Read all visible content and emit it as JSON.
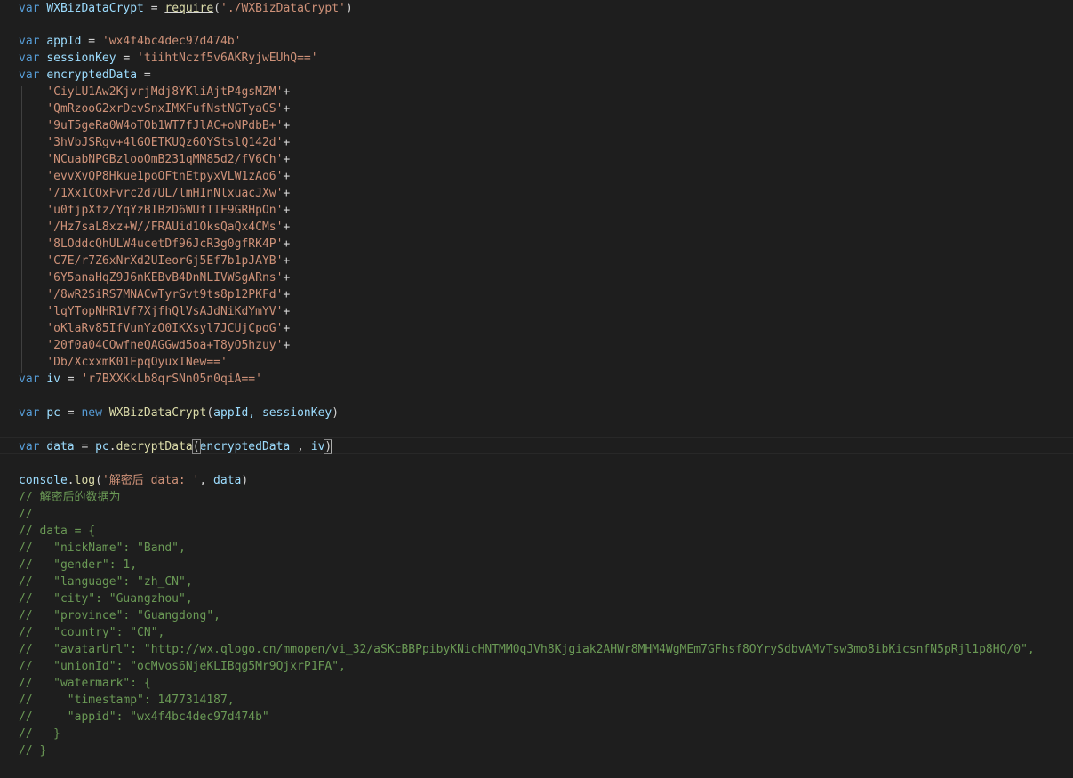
{
  "editor": {
    "keywords": {
      "var": "var",
      "new": "new"
    },
    "line1": {
      "ident": "WXBizDataCrypt",
      "op": " = ",
      "fn": "require",
      "str": "'./WXBizDataCrypt'"
    },
    "appId": {
      "name": "appId",
      "value": "'wx4f4bc4dec97d474b'"
    },
    "sessionKey": {
      "name": "sessionKey",
      "value": "'tiihtNczf5v6AKRyjwEUhQ=='"
    },
    "encrypted": {
      "name": "encryptedData",
      "parts": [
        "'CiyLU1Aw2KjvrjMdj8YKliAjtP4gsMZM'",
        "'QmRzooG2xrDcvSnxIMXFufNstNGTyaGS'",
        "'9uT5geRa0W4oTOb1WT7fJlAC+oNPdbB+'",
        "'3hVbJSRgv+4lGOETKUQz6OYStslQ142d'",
        "'NCuabNPGBzlooOmB231qMM85d2/fV6Ch'",
        "'evvXvQP8Hkue1poOFtnEtpyxVLW1zAo6'",
        "'/1Xx1COxFvrc2d7UL/lmHInNlxuacJXw'",
        "'u0fjpXfz/YqYzBIBzD6WUfTIF9GRHpOn'",
        "'/Hz7saL8xz+W//FRAUid1OksQaQx4CMs'",
        "'8LOddcQhULW4ucetDf96JcR3g0gfRK4P'",
        "'C7E/r7Z6xNrXd2UIeorGj5Ef7b1pJAYB'",
        "'6Y5anaHqZ9J6nKEBvB4DnNLIVWSgARns'",
        "'/8wR2SiRS7MNACwTyrGvt9ts8p12PKFd'",
        "'lqYTopNHR1Vf7XjfhQlVsAJdNiKdYmYV'",
        "'oKlaRv85IfVunYzO0IKXsyl7JCUjCpoG'",
        "'20f0a04COwfneQAGGwd5oa+T8yO5hzuy'",
        "'Db/XcxxmK01EpqOyuxINew=='"
      ]
    },
    "iv": {
      "name": "iv",
      "value": "'r7BXXKkLb8qrSNn05n0qiA=='"
    },
    "pcLine": {
      "name": "pc",
      "cls": "WXBizDataCrypt",
      "args": "appId, sessionKey"
    },
    "dataLine": {
      "name": "data",
      "obj": "pc",
      "method": "decryptData",
      "arg1": "encryptedData",
      "arg2": "iv"
    },
    "logLine": {
      "obj": "console",
      "method": "log",
      "str": "'解密后 data: '",
      "arg": "data"
    },
    "comments": {
      "c1": "// 解密后的数据为",
      "c2": "//",
      "c3": "// data = {",
      "c4": "//   \"nickName\": \"Band\",",
      "c5a": "//   \"gender\": ",
      "c5b": "1",
      "c5c": ",",
      "c6": "//   \"language\": \"zh_CN\",",
      "c7": "//   \"city\": \"Guangzhou\",",
      "c8": "//   \"province\": \"Guangdong\",",
      "c9": "//   \"country\": \"CN\",",
      "c10a": "//   \"avatarUrl\": \"",
      "c10url": "http://wx.qlogo.cn/mmopen/vi_32/aSKcBBPpibyKNicHNTMM0qJVh8Kjgiak2AHWr8MHM4WgMEm7GFhsf8OYrySdbvAMvTsw3mo8ibKicsnfN5pRjl1p8HQ/0",
      "c10b": "\",",
      "c11": "//   \"unionId\": \"ocMvos6NjeKLIBqg5Mr9QjxrP1FA\",",
      "c12": "//   \"watermark\": {",
      "c13a": "//     \"timestamp\": ",
      "c13b": "1477314187",
      "c13c": ",",
      "c14": "//     \"appid\": \"wx4f4bc4dec97d474b\"",
      "c15": "//   }",
      "c16": "// }"
    },
    "colors": {
      "background": "#1e1e1e",
      "keyword": "#569cd6",
      "variable": "#9cdcfe",
      "function": "#dcdcaa",
      "string": "#ce9178",
      "comment": "#6a9955",
      "number": "#b5cea8"
    }
  }
}
